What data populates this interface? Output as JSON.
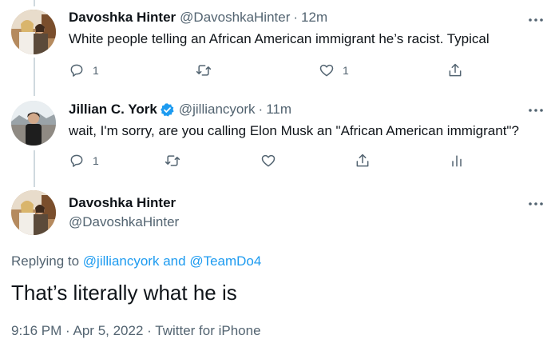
{
  "tweets": [
    {
      "display_name": "Davoshka Hinter",
      "handle": "@DavoshkaHinter",
      "dot": "·",
      "time": "12m",
      "text": "White people telling an African American immigrant he’s racist. Typical",
      "reply_count": "1",
      "retweet_count": "",
      "like_count": "1"
    },
    {
      "display_name": "Jillian C. York",
      "verified": true,
      "handle": "@jilliancyork",
      "dot": "·",
      "time": "11m",
      "text": "wait, I'm sorry, are you calling Elon Musk an \"African American immigrant\"?",
      "reply_count": "1",
      "retweet_count": "",
      "like_count": ""
    }
  ],
  "main_tweet": {
    "display_name": "Davoshka Hinter",
    "handle": "@DavoshkaHinter",
    "replying_prefix": "Replying to",
    "replying_user1": "@jilliancyork",
    "replying_and": "and",
    "replying_user2": "@TeamDo4",
    "text": "That’s literally what he is",
    "time": "9:16 PM",
    "date": "Apr 5, 2022",
    "source": "Twitter for iPhone",
    "sep": "·"
  },
  "colors": {
    "text": "#0f1419",
    "secondary": "#536471",
    "link": "#1d9bf0",
    "verified": "#1d9bf0",
    "thread_line": "#cfd9de"
  }
}
